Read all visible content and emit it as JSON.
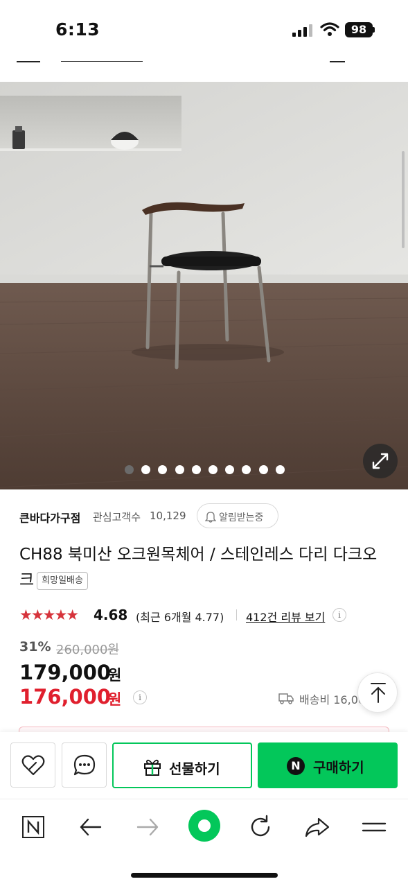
{
  "status_bar": {
    "time": "6:13",
    "battery": "98",
    "icons": [
      "cellular-signal-icon",
      "wifi-icon",
      "battery-icon"
    ]
  },
  "gallery": {
    "image": "chair-photo",
    "dot_count": 10,
    "active_index": 0,
    "icons": [
      "expand-icon"
    ]
  },
  "seller": {
    "name": "큰바다가구점",
    "followers_label": "관심고객수",
    "followers_count": "10,129",
    "alert_label": "알림받는중",
    "icons": [
      "bell-icon"
    ]
  },
  "product": {
    "title": "CH88 북미산 오크원목체어 / 스테인레스 다리 다크오크",
    "delivery_tag": "희망일배송"
  },
  "rating": {
    "stars": "★★★★★",
    "stars_value": 4.68,
    "score": "4.68",
    "recent": "(최근 6개월 4.77)",
    "review_link": "412건 리뷰 보기"
  },
  "price": {
    "discount": "31%",
    "original": "260,000원",
    "sale": "179,000",
    "sale_unit": "원",
    "pay": "176,000",
    "pay_unit": "원",
    "shipping": "배송비 16,000원"
  },
  "actions": {
    "gift_label": "선물하기",
    "buy_badge": "N",
    "buy_label": "구매하기",
    "icons": [
      "wishlist-heart-icon",
      "chat-icon",
      "gift-icon"
    ]
  },
  "browser_toolbar": {
    "n_label": "N",
    "icons": [
      "naver-n-icon",
      "back-arrow-icon",
      "forward-arrow-icon",
      "home-icon",
      "refresh-icon",
      "share-icon",
      "menu-icon"
    ]
  },
  "colors": {
    "naver_green": "#03c75a",
    "price_red": "#e0202e",
    "star_red": "#d6333b"
  }
}
